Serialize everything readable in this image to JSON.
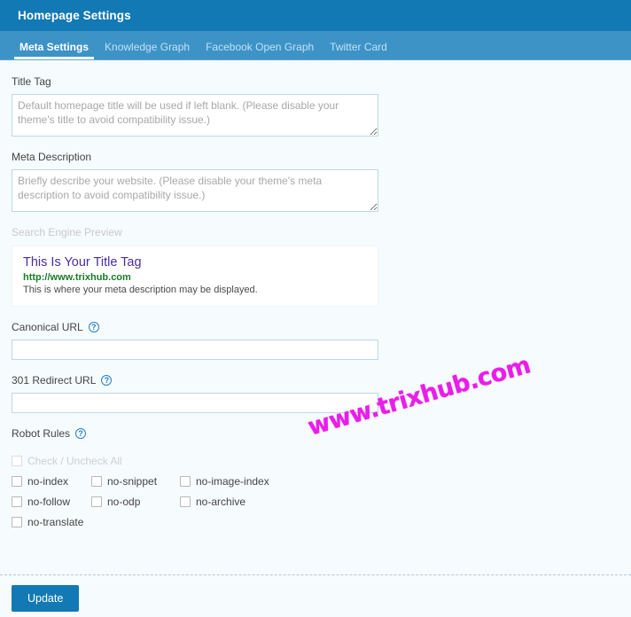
{
  "header": {
    "title": "Homepage Settings"
  },
  "tabs": [
    {
      "label": "Meta Settings",
      "active": true
    },
    {
      "label": "Knowledge Graph",
      "active": false
    },
    {
      "label": "Facebook Open Graph",
      "active": false
    },
    {
      "label": "Twitter Card",
      "active": false
    }
  ],
  "fields": {
    "title_tag": {
      "label": "Title Tag",
      "placeholder": "Default homepage title will be used if left blank. (Please disable your theme's title to avoid compatibility issue.)",
      "value": ""
    },
    "meta_description": {
      "label": "Meta Description",
      "placeholder": "Briefly describe your website. (Please disable your theme's meta description to avoid compatibility issue.)",
      "value": ""
    },
    "canonical_url": {
      "label": "Canonical URL",
      "help_icon": "question-mark-circle-icon",
      "help_glyph": "?",
      "value": ""
    },
    "redirect_url": {
      "label": "301 Redirect URL",
      "help_icon": "question-mark-circle-icon",
      "help_glyph": "?",
      "value": ""
    }
  },
  "serp_preview": {
    "label": "Search Engine Preview",
    "title": "This Is Your Title Tag",
    "url": "http://www.trixhub.com",
    "description": "This is where your meta description may be displayed.",
    "title_color": "#4b2d9f",
    "url_color": "#1b7a28"
  },
  "robot_rules": {
    "label": "Robot Rules",
    "help_glyph": "?",
    "check_all": {
      "label": "Check / Uncheck All",
      "checked": false
    },
    "rows": [
      [
        {
          "label": "no-index",
          "checked": false
        },
        {
          "label": "no-snippet",
          "checked": false
        },
        {
          "label": "no-image-index",
          "checked": false
        }
      ],
      [
        {
          "label": "no-follow",
          "checked": false
        },
        {
          "label": "no-odp",
          "checked": false
        },
        {
          "label": "no-archive",
          "checked": false
        }
      ],
      [
        {
          "label": "no-translate",
          "checked": false
        }
      ]
    ]
  },
  "footer": {
    "update_label": "Update"
  },
  "watermark": {
    "text": "www.trixhub.com",
    "color": "#e81ee8"
  },
  "theme": {
    "header_bg": "#1279b4",
    "tabbar_bg": "#3d93c6",
    "page_bg": "#f6fbfd",
    "input_border": "#bcd8ea",
    "button_bg": "#1279b4"
  }
}
